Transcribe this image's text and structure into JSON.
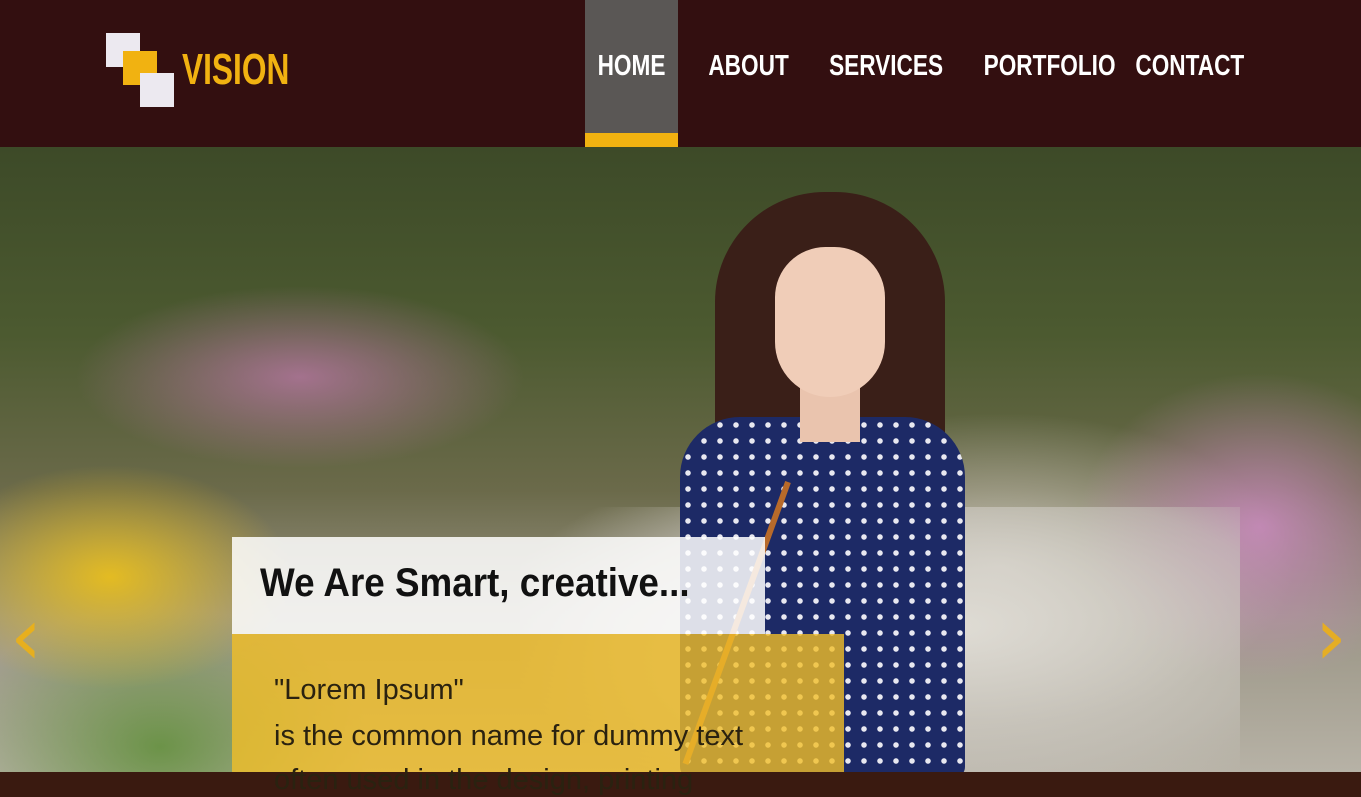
{
  "brand": {
    "name": "VISION"
  },
  "nav": {
    "items": [
      {
        "label": "HOME",
        "active": true
      },
      {
        "label": "ABOUT",
        "active": false
      },
      {
        "label": "SERVICES",
        "active": false
      },
      {
        "label": "PORTFOLIO",
        "active": false
      },
      {
        "label": "CONTACT",
        "active": false
      }
    ]
  },
  "slider": {
    "title": "We Are Smart, creative...",
    "lines": [
      "\"Lorem Ipsum\"",
      "is the common name for dummy text",
      "often used in the design, printing"
    ],
    "prev_icon": "chevron-left-icon",
    "next_icon": "chevron-right-icon"
  },
  "colors": {
    "header_bg": "#330f10",
    "accent": "#f1b211",
    "active_nav_bg": "#5a5755"
  }
}
